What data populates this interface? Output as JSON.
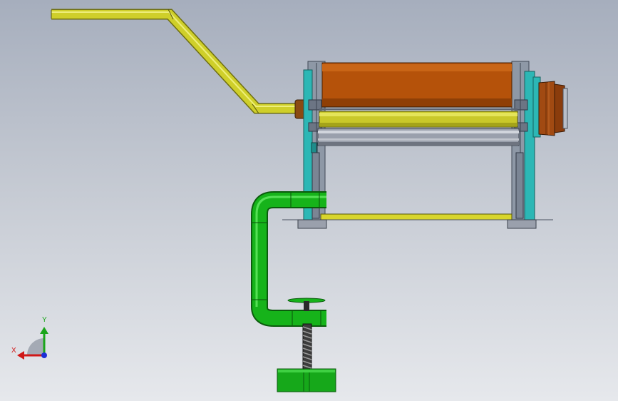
{
  "viewport": {
    "colors": {
      "handle": "#cfcf2a",
      "roller_orange": "#b5520a",
      "roller_yellow": "#c9c82a",
      "roller_steel": "#9aa0ac",
      "frame_teal": "#2cb7b5",
      "frame_gray": "#8e98a6",
      "clamp_green": "#16b31a",
      "pulley": "#a14a12",
      "tray": "#d8d52c"
    }
  },
  "triad": {
    "x_label": "X",
    "y_label": "Y",
    "x_color": "#d01818",
    "y_color": "#1aa51a",
    "z_color": "#1c2fd6"
  }
}
